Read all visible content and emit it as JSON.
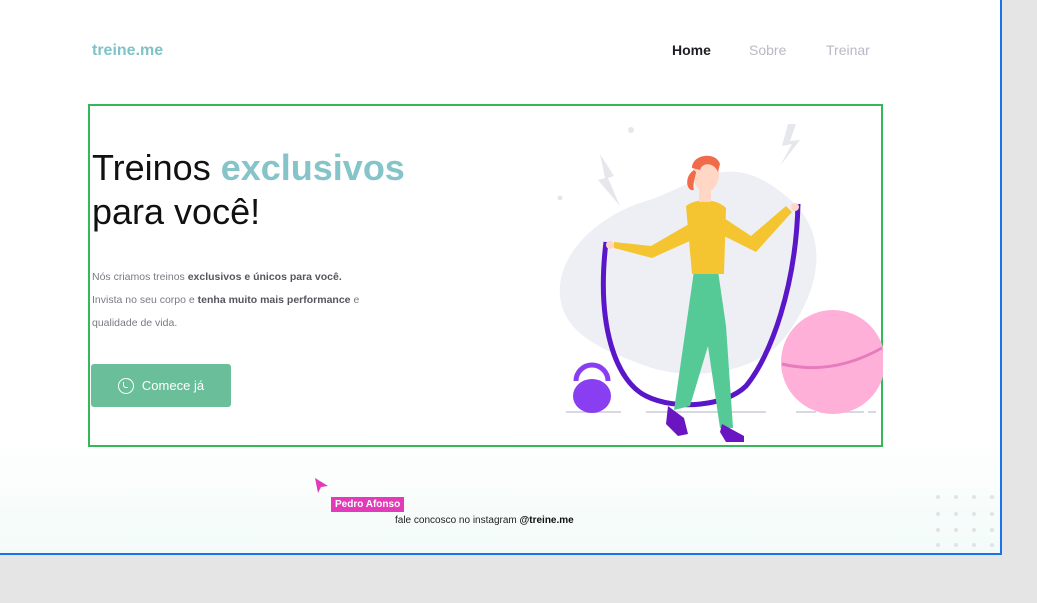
{
  "brand": {
    "logo": "treine.me"
  },
  "nav": {
    "items": [
      "Home",
      "Sobre",
      "Treinar"
    ],
    "active": "Home"
  },
  "hero": {
    "headline_line1_plain": "Treinos ",
    "headline_line1_accent": "exclusivos",
    "headline_line2": "para você!",
    "desc_part1": "Nós criamos treinos ",
    "desc_bold1": "exclusivos e únicos para você.",
    "desc_part2": "Invista no seu corpo e ",
    "desc_bold2": "tenha muito mais performance",
    "desc_part3": " e qualidade de vida.",
    "cta_label": "Comece já"
  },
  "collaborator": {
    "name": "Pedro Afonso"
  },
  "footer": {
    "text": "fale concosco no instagram ",
    "handle": "@treine.me"
  },
  "colors": {
    "accent": "#85c4c9",
    "cta": "#6abf9a",
    "selection_border": "#36b85a",
    "frame_border": "#1a73e8",
    "collab_tag": "#e23ab9"
  },
  "icons": [
    "whatsapp-icon",
    "cursor-pointer-icon"
  ]
}
